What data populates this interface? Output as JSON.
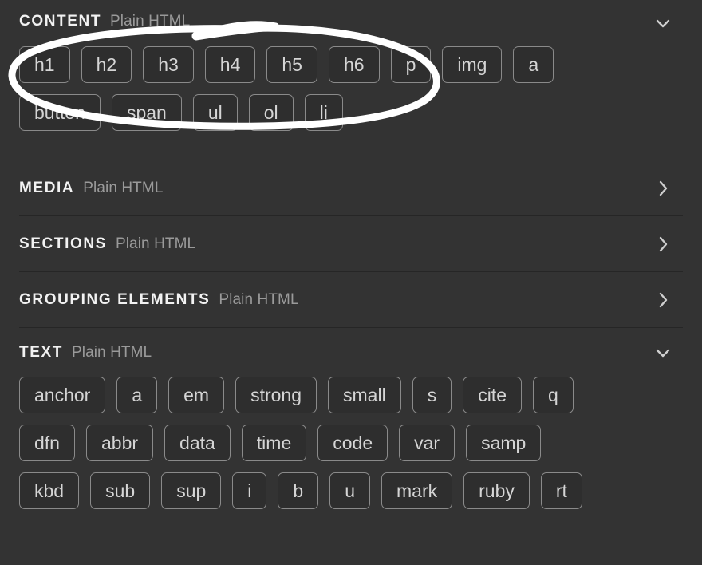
{
  "panel": {
    "background_color": "#333333",
    "chip_border_color": "#8a8a8a",
    "chip_background_color": "#2e2e2e",
    "divider_color": "#262626",
    "annotation_color": "#ffffff"
  },
  "sections": [
    {
      "title": "CONTENT",
      "subtitle": "Plain HTML",
      "expanded": true,
      "toggle_icon": "chevron-down-icon",
      "rows": [
        [
          "h1",
          "h2",
          "h3",
          "h4",
          "h5",
          "h6",
          "p",
          "img",
          "a"
        ],
        [
          "button",
          "span",
          "ul",
          "ol",
          "li"
        ]
      ]
    },
    {
      "title": "MEDIA",
      "subtitle": "Plain HTML",
      "expanded": false,
      "toggle_icon": "chevron-right-icon",
      "rows": []
    },
    {
      "title": "SECTIONS",
      "subtitle": "Plain HTML",
      "expanded": false,
      "toggle_icon": "chevron-right-icon",
      "rows": []
    },
    {
      "title": "GROUPING ELEMENTS",
      "subtitle": "Plain HTML",
      "expanded": false,
      "toggle_icon": "chevron-right-icon",
      "rows": []
    },
    {
      "title": "TEXT",
      "subtitle": "Plain HTML",
      "expanded": true,
      "toggle_icon": "chevron-down-icon",
      "rows": [
        [
          "anchor",
          "a",
          "em",
          "strong",
          "small",
          "s",
          "cite",
          "q"
        ],
        [
          "dfn",
          "abbr",
          "data",
          "time",
          "code",
          "var",
          "samp"
        ],
        [
          "kbd",
          "sub",
          "sup",
          "i",
          "b",
          "u",
          "mark",
          "ruby",
          "rt"
        ]
      ]
    }
  ],
  "annotation": {
    "type": "hand-drawn-ellipse",
    "color": "#ffffff",
    "encircles": [
      "h1",
      "h2",
      "h3",
      "h4",
      "h5",
      "h6"
    ]
  }
}
